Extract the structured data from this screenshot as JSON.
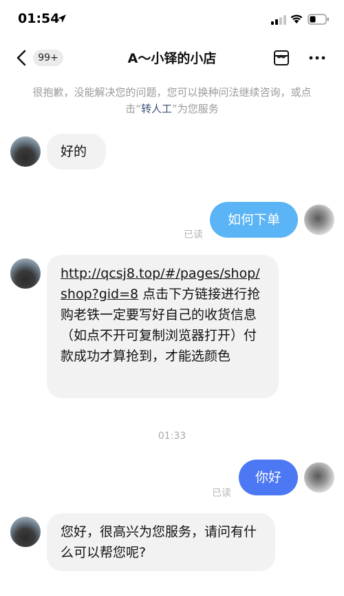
{
  "status": {
    "time": "01:54"
  },
  "nav": {
    "unread_badge": "99+",
    "title": "A～小铎的小店"
  },
  "notice": {
    "before": "很抱歉，没能解决您的问题，您可以换种问法继续咨询，或点击“",
    "link": "转人工",
    "after": "”为您服务"
  },
  "messages": {
    "m1": {
      "text": "好的"
    },
    "m2": {
      "text": "如何下单",
      "read": "已读"
    },
    "m3": {
      "url_line1": "http://qcsj8.top/#/pages/shop/",
      "url_line2": "shop?gid=8",
      "text_rest": " 点击下方链接进行抢购老铁一定要写好自己的收货信息（如点不开可复制浏览器打开）付款成功才算抢到，才能选颜色"
    },
    "timestamp": "01:33",
    "m4": {
      "text": "你好",
      "read": "已读"
    },
    "m5": {
      "text": "您好，很高兴为您服务，请问有什么可以帮您呢?"
    }
  },
  "colors": {
    "bubble_light_blue": "#5bb4f5",
    "bubble_blue": "#4d78f3",
    "bubble_gray": "#f2f2f2",
    "link": "#3a4e7a"
  }
}
